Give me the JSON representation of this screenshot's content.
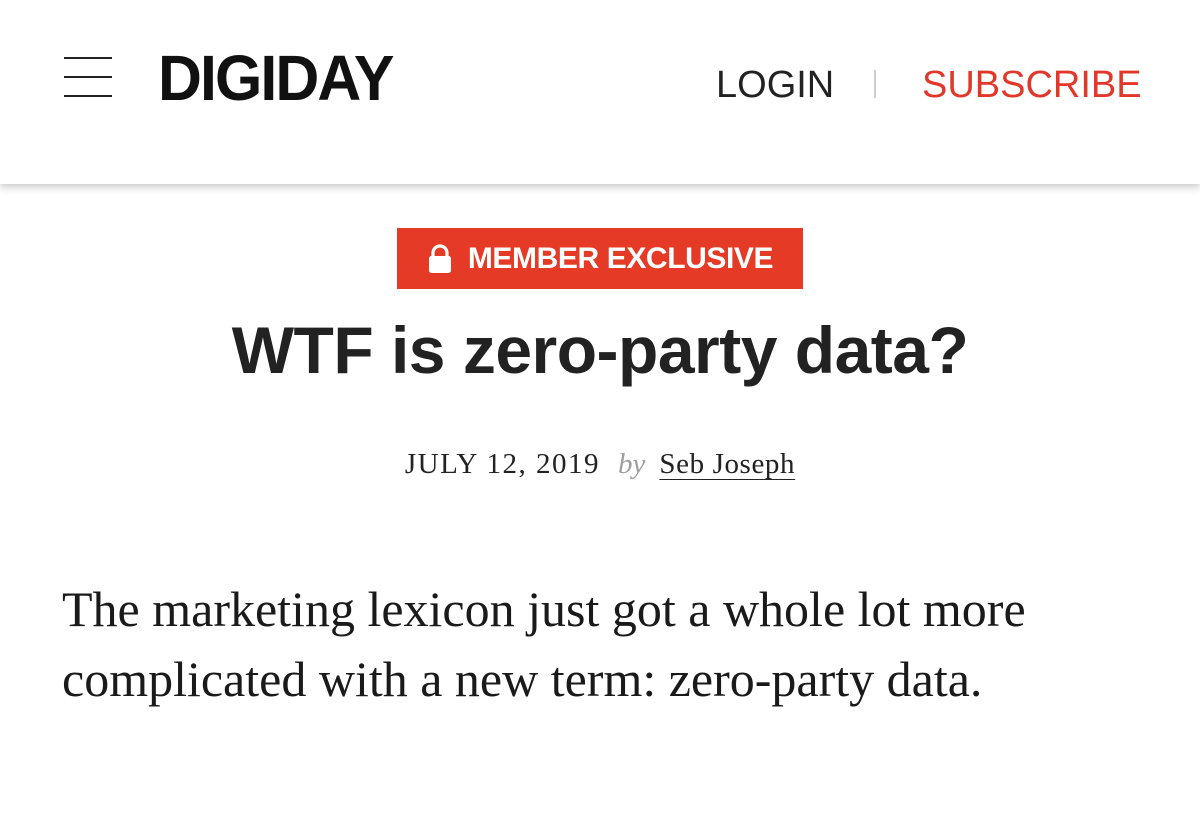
{
  "header": {
    "logo_text": "DIGIDAY",
    "login_label": "LOGIN",
    "subscribe_label": "SUBSCRIBE"
  },
  "article": {
    "badge_label": "MEMBER EXCLUSIVE",
    "title": "WTF is zero-party data?",
    "date": "JULY 12, 2019",
    "by_label": "by",
    "author": "Seb Joseph",
    "intro": "The marketing lexicon just got a whole lot more complicated with a new term: zero-party data."
  },
  "icons": {
    "menu": "hamburger-menu-icon",
    "badge": "lock-icon"
  },
  "colors": {
    "accent_red": "#e53a26",
    "subscribe_red": "#e2382c",
    "text": "#1a1a1a",
    "muted": "#9e9e9e"
  }
}
